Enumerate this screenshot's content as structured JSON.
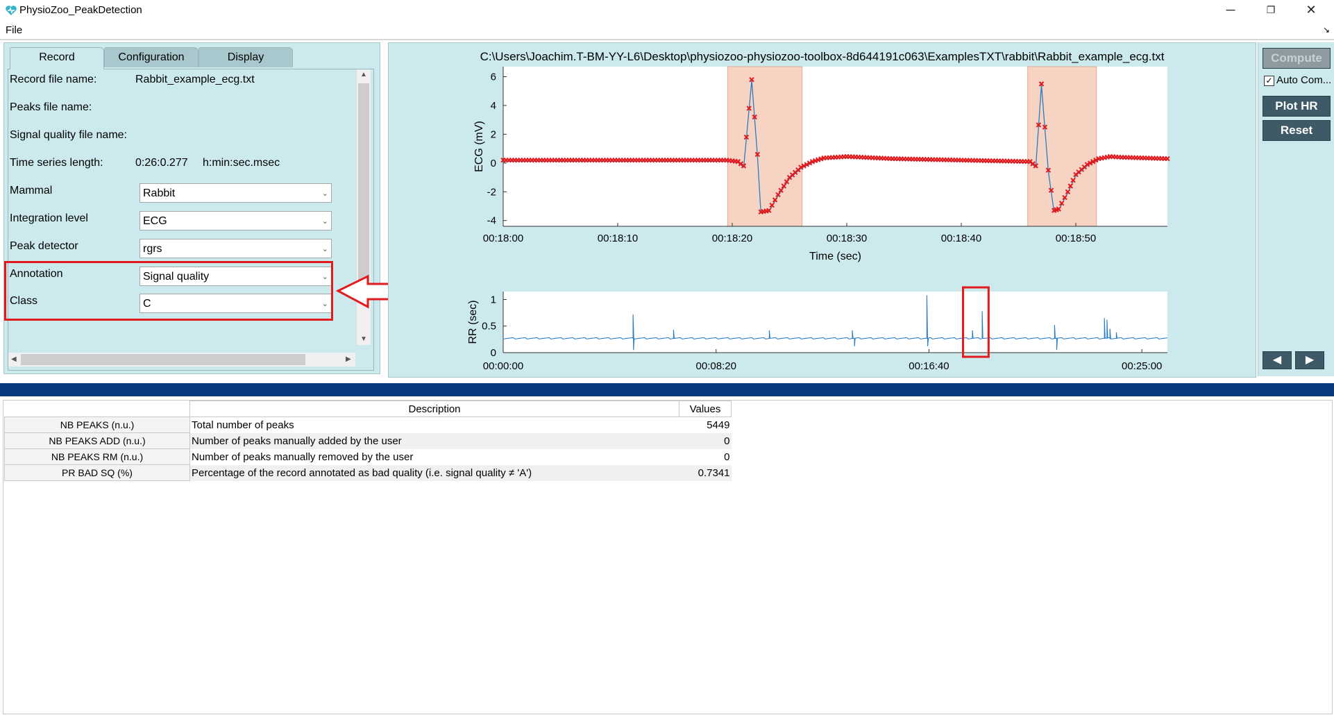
{
  "window": {
    "title": "PhysioZoo_PeakDetection",
    "minimize": "─",
    "restore": "❐",
    "close": "✕"
  },
  "menu": {
    "file": "File",
    "dock_glyph": "↘"
  },
  "tabs": [
    {
      "label": "Record",
      "active": true
    },
    {
      "label": "Configuration",
      "active": false
    },
    {
      "label": "Display",
      "active": false
    }
  ],
  "record": {
    "record_file_label": "Record file name:",
    "record_file_value": "Rabbit_example_ecg.txt",
    "peaks_file_label": "Peaks file name:",
    "sq_file_label": "Signal quality file name:",
    "ts_length_label": "Time series length:",
    "ts_length_value": "0:26:0.277",
    "ts_length_unit": "h:min:sec.msec",
    "mammal_label": "Mammal",
    "mammal_value": "Rabbit",
    "integration_label": "Integration level",
    "integration_value": "ECG",
    "detector_label": "Peak detector",
    "detector_value": "rgrs",
    "annotation_label": "Annotation",
    "annotation_value": "Signal quality",
    "class_label": "Class",
    "class_value": "C"
  },
  "plot": {
    "title": "C:\\Users\\Joachim.T-BM-YY-L6\\Desktop\\physiozoo-physiozoo-toolbox-8d644191c063\\ExamplesTXT\\rabbit\\Rabbit_example_ecg.txt"
  },
  "chart_data": [
    {
      "type": "line",
      "ylabel": "ECG (mV)",
      "xlabel": "Time (sec)",
      "xlim_sec": [
        1080,
        1138
      ],
      "ylim": [
        -4.4,
        6.7
      ],
      "yticks": [
        6,
        4,
        2,
        0,
        -2,
        -4
      ],
      "ytick_labels": [
        "6",
        "4",
        "2",
        "0",
        "-2",
        "-4"
      ],
      "xticks_sec": [
        1080,
        1090,
        1100,
        1110,
        1120,
        1130
      ],
      "xtick_labels": [
        "00:18:00",
        "00:18:10",
        "00:18:20",
        "00:18:30",
        "00:18:40",
        "00:18:50"
      ],
      "line_color": "#2b7bbf",
      "marker_color": "#e3191c",
      "highlight_color": "#f6d3c3",
      "highlight_regions_sec": [
        [
          1099.6,
          1106.1
        ],
        [
          1125.8,
          1131.8
        ]
      ],
      "x": [
        1080,
        1088,
        1096,
        1099.5,
        1100.5,
        1101.0,
        1101.7,
        1102.2,
        1102.5,
        1103.2,
        1104,
        1105,
        1106,
        1107,
        1108,
        1110,
        1114,
        1120,
        1126,
        1126.5,
        1127,
        1127.6,
        1128.1,
        1128.5,
        1129.3,
        1130,
        1131,
        1132,
        1133,
        1134,
        1136,
        1138
      ],
      "y": [
        0.2,
        0.2,
        0.2,
        0.2,
        0.1,
        -0.2,
        5.8,
        0.6,
        -3.4,
        -3.3,
        -2.2,
        -1.0,
        -0.3,
        0.1,
        0.35,
        0.45,
        0.3,
        0.2,
        0.1,
        -0.2,
        5.5,
        -0.5,
        -3.3,
        -3.2,
        -2.0,
        -0.8,
        -0.1,
        0.3,
        0.45,
        0.4,
        0.35,
        0.3
      ]
    },
    {
      "type": "line",
      "ylabel": "RR (sec)",
      "xlim_sec": [
        0,
        1560
      ],
      "ylim": [
        0,
        1.15
      ],
      "yticks": [
        1,
        0.5,
        0
      ],
      "ytick_labels": [
        "1",
        "0.5",
        "0"
      ],
      "xticks_sec": [
        0,
        500,
        1000,
        1500
      ],
      "xtick_labels": [
        "00:00:00",
        "00:08:20",
        "00:16:40",
        "00:25:00"
      ],
      "line_color": "#2b7bbf",
      "baseline": 0.27,
      "spikes": [
        [
          305,
          0.72
        ],
        [
          306,
          0.05
        ],
        [
          400,
          0.43
        ],
        [
          625,
          0.42
        ],
        [
          820,
          0.42
        ],
        [
          825,
          0.12
        ],
        [
          995,
          1.08
        ],
        [
          997,
          0.12
        ],
        [
          1102,
          0.42
        ],
        [
          1125,
          0.78
        ],
        [
          1295,
          0.52
        ],
        [
          1300,
          0.05
        ],
        [
          1412,
          0.65
        ],
        [
          1418,
          0.62
        ],
        [
          1425,
          0.45
        ],
        [
          1440,
          0.38
        ]
      ],
      "highlight_window_sec": [
        1080,
        1140
      ],
      "highlight_color": "#e3191c"
    }
  ],
  "buttons": {
    "compute": "Compute",
    "auto_compute": "Auto Com...",
    "auto_compute_checked": "✓",
    "plot_hr": "Plot HR",
    "reset": "Reset",
    "prev": "◀",
    "next": "▶"
  },
  "table": {
    "headers": {
      "description": "Description",
      "values": "Values"
    },
    "rows": [
      {
        "name": "NB PEAKS (n.u.)",
        "description": "Total number of peaks",
        "value": "5449"
      },
      {
        "name": "NB PEAKS ADD (n.u.)",
        "description": "Number of peaks manually added by the user",
        "value": "0"
      },
      {
        "name": "NB PEAKS RM (n.u.)",
        "description": "Number of peaks manually removed by the user",
        "value": "0"
      },
      {
        "name": "PR BAD SQ (%)",
        "description": "Percentage of the record annotated as bad quality (i.e. signal quality ≠ 'A')",
        "value": "0.7341"
      }
    ]
  }
}
